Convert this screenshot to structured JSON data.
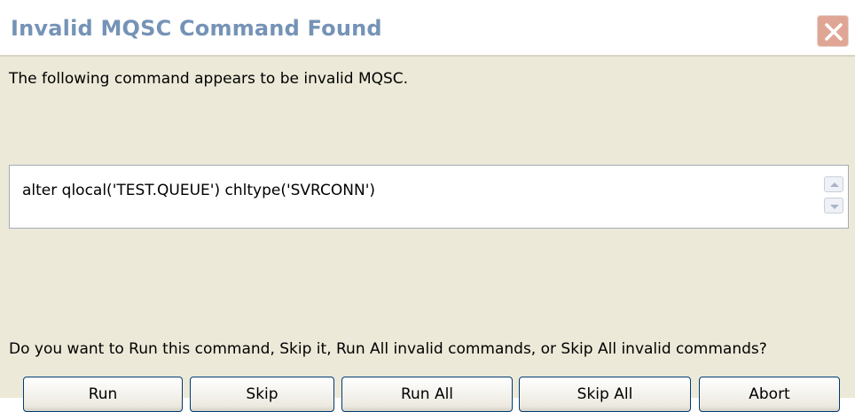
{
  "dialog": {
    "title": "Invalid MQSC Command Found",
    "message": "The following command appears to be invalid MQSC.",
    "command": "alter qlocal('TEST.QUEUE') chltype('SVRCONN')",
    "prompt": "Do you want to Run this command, Skip it, Run All invalid commands, or Skip All invalid commands?",
    "buttons": {
      "run": "Run",
      "skip": "Skip",
      "run_all": "Run All",
      "skip_all": "Skip All",
      "abort": "Abort"
    }
  },
  "icons": {
    "close": "close-icon",
    "scroll_up": "scroll-up-icon",
    "scroll_down": "scroll-down-icon"
  },
  "colors": {
    "title_text": "#7593b6",
    "close_button": "#e0a695",
    "dialog_background": "#ece9d8",
    "button_border": "#003c74"
  }
}
